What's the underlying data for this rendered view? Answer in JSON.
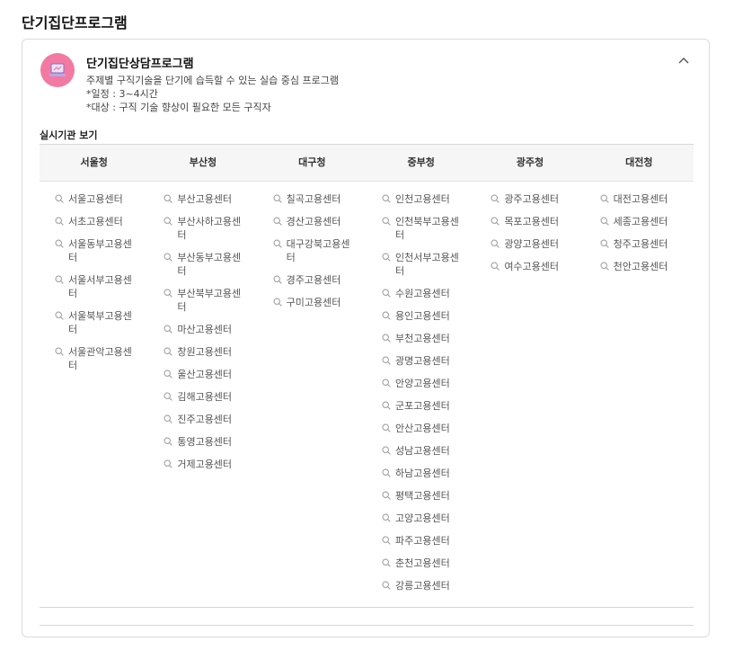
{
  "page_title": "단기집단프로그램",
  "program": {
    "title": "단기집단상담프로그램",
    "description": "주제별 구직기술을 단기에 습득할 수 있는 실습 중심 프로그램",
    "schedule": "*일정 : 3~4시간",
    "target": "*대상 : 구직 기술 향상이 필요한 모든 구직자",
    "avatar_color": "#f27aa2"
  },
  "agencies": {
    "label": "실시기관 보기",
    "regions": [
      {
        "name": "서울청",
        "centers": [
          "서울고용센터",
          "서초고용센터",
          "서울동부고용센터",
          "서울서부고용센터",
          "서울북부고용센터",
          "서울관악고용센터"
        ]
      },
      {
        "name": "부산청",
        "centers": [
          "부산고용센터",
          "부산사하고용센터",
          "부산동부고용센터",
          "부산북부고용센터",
          "마산고용센터",
          "창원고용센터",
          "울산고용센터",
          "김해고용센터",
          "진주고용센터",
          "통영고용센터",
          "거제고용센터"
        ]
      },
      {
        "name": "대구청",
        "centers": [
          "칠곡고용센터",
          "경산고용센터",
          "대구강북고용센터",
          "경주고용센터",
          "구미고용센터"
        ]
      },
      {
        "name": "중부청",
        "centers": [
          "인천고용센터",
          "인천북부고용센터",
          "인천서부고용센터",
          "수원고용센터",
          "용인고용센터",
          "부천고용센터",
          "광명고용센터",
          "안양고용센터",
          "군포고용센터",
          "안산고용센터",
          "성남고용센터",
          "하남고용센터",
          "평택고용센터",
          "고양고용센터",
          "파주고용센터",
          "춘천고용센터",
          "강릉고용센터"
        ]
      },
      {
        "name": "광주청",
        "centers": [
          "광주고용센터",
          "목포고용센터",
          "광양고용센터",
          "여수고용센터"
        ]
      },
      {
        "name": "대전청",
        "centers": [
          "대전고용센터",
          "세종고용센터",
          "청주고용센터",
          "천안고용센터"
        ]
      }
    ]
  },
  "icons": {
    "collapse": "chevron-up-icon",
    "center": "search-icon"
  }
}
